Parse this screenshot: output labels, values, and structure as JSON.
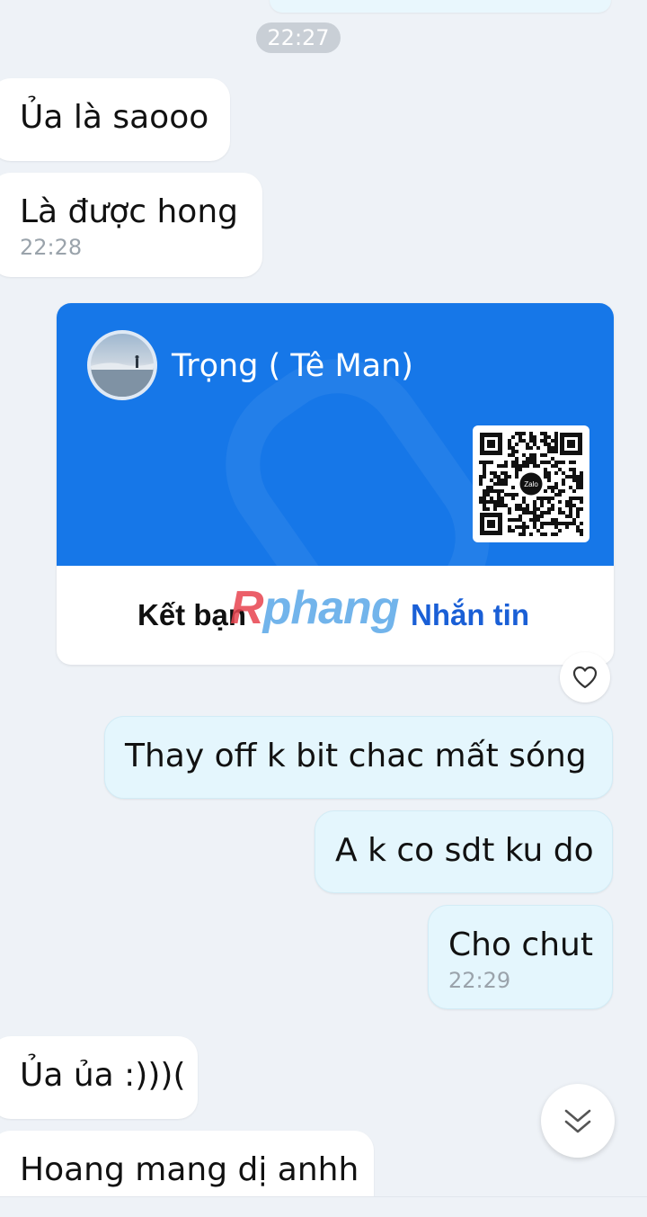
{
  "chat": {
    "time_separator": "22:27",
    "messages": [
      {
        "text": "Ủa là saooo"
      },
      {
        "text": "Là được hong",
        "time": "22:28"
      },
      {
        "text": "Thay off k bit chac mất sóng"
      },
      {
        "text": "A k co sdt ku do"
      },
      {
        "text": "Cho chut",
        "time": "22:29"
      },
      {
        "text": "Ủa ủa :)))("
      },
      {
        "text": "Hoang mang dị anhh"
      }
    ]
  },
  "contact_card": {
    "name": "Trọng ( Tê Man)",
    "qr_logo": "Zalo",
    "add_friend_label": "Kết bạn",
    "message_label": "Nhắn tin",
    "accent_color": "#1677e8"
  },
  "watermark": {
    "part1": "R",
    "part2": "phang"
  },
  "icons": {
    "reaction": "heart-icon",
    "scroll": "chevron-double-down-icon"
  }
}
